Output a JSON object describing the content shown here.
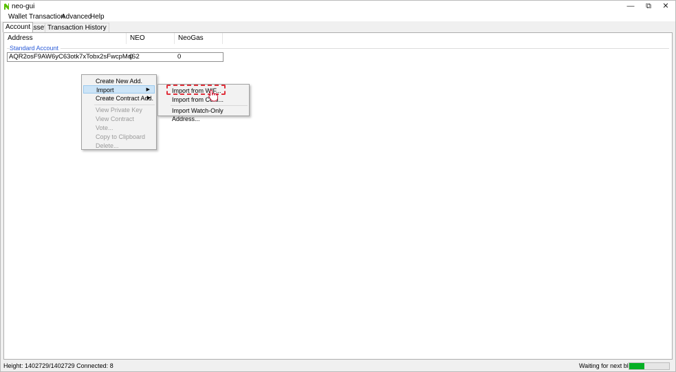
{
  "window": {
    "title": "neo-gui",
    "minimize_glyph": "—",
    "restore_glyph": "⧉",
    "close_glyph": "✕"
  },
  "menu": [
    "Wallet",
    "Transaction",
    "Advanced",
    "Help"
  ],
  "tabs": [
    {
      "label": "Account",
      "active": true
    },
    {
      "label": "Asset",
      "active": false
    },
    {
      "label": "Transaction History",
      "active": false
    }
  ],
  "table": {
    "headers": [
      "Address",
      "NEO",
      "NeoGas"
    ],
    "group": "Standard Account",
    "rows": [
      {
        "address": "AQR2osF9AW6yC63otk7xTobx2sFwcpMqS2",
        "neo": "0",
        "neogas": "0"
      }
    ]
  },
  "context_menu": {
    "items": [
      {
        "label": "Create New Add.",
        "enabled": true
      },
      {
        "label": "Import",
        "enabled": true,
        "submenu": true
      },
      {
        "label": "Create Contract Add.",
        "enabled": true,
        "submenu": true
      },
      {
        "label": "View Private Key",
        "enabled": false
      },
      {
        "label": "View Contract",
        "enabled": false
      },
      {
        "label": "Vote...",
        "enabled": false
      },
      {
        "label": "Copy to Clipboard",
        "enabled": false
      },
      {
        "label": "Delete...",
        "enabled": false
      }
    ]
  },
  "import_submenu": {
    "items": [
      {
        "label": "Import from WIF..."
      },
      {
        "label": "Import from Certi..."
      },
      {
        "label": "Import Watch-Only Address..."
      }
    ]
  },
  "status": {
    "height_label": "Height:",
    "height_value": "1402729/1402729",
    "connected_label": "Connected:",
    "connected_value": "8",
    "waiting_label": "Waiting for next block:",
    "progress_fraction": 0.38
  },
  "colors": {
    "accent_blue": "#2a5bd7",
    "highlight": "#cce4f7",
    "annotation_red": "#e0303a",
    "progress_green": "#06b025"
  }
}
